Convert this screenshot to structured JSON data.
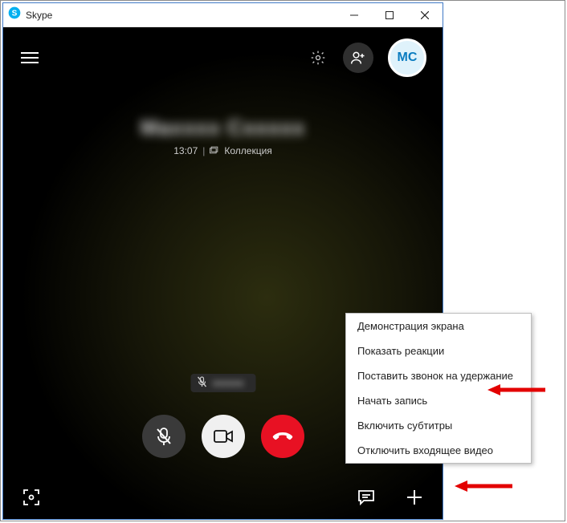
{
  "window": {
    "title": "Skype"
  },
  "avatar": {
    "initials": "MC"
  },
  "caller": {
    "name_blurred": "Maxxxx  Cxxxxx",
    "time": "13:07",
    "separator": "|",
    "status": "Коллекция"
  },
  "muted_badge": {
    "text_blurred": "xxxxxx"
  },
  "menu": {
    "items": [
      "Демонстрация экрана",
      "Показать реакции",
      "Поставить звонок на удержание",
      "Начать запись",
      "Включить субтитры",
      "Отключить входящее видео"
    ]
  }
}
